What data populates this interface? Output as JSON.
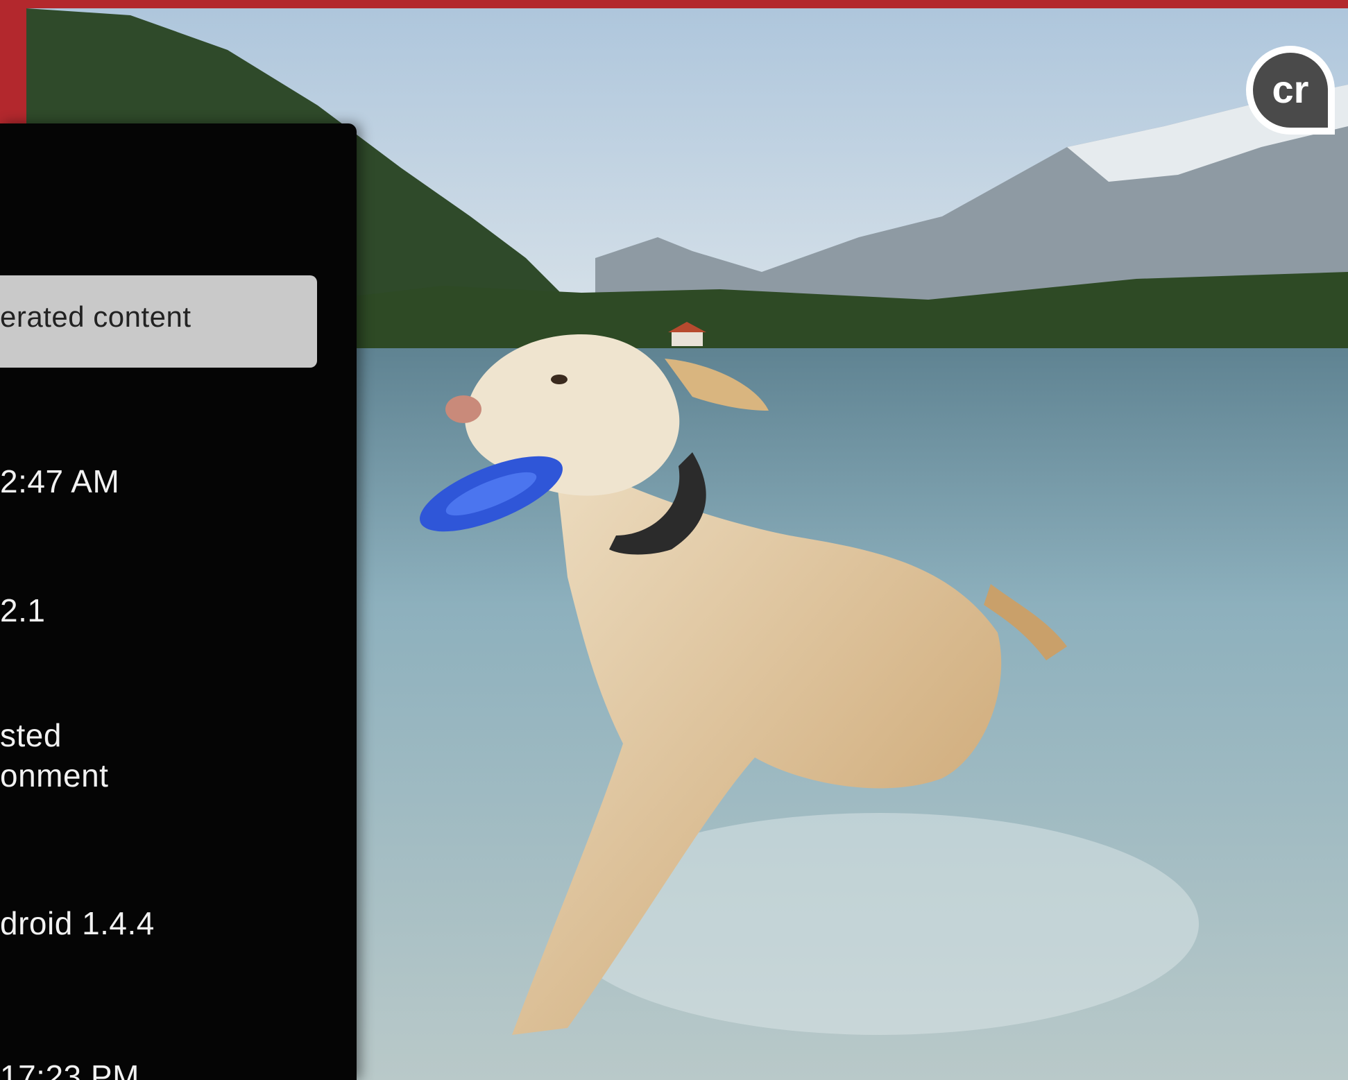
{
  "colors": {
    "accent": "#b3282d",
    "panel": "#050505",
    "selected_item": "#c9c9c9"
  },
  "panel": {
    "selected_item_label": "erated content",
    "rows": [
      {
        "value": "2:47 AM"
      },
      {
        "value": "2.1"
      },
      {
        "value": "sted\nonment"
      },
      {
        "value": "droid 1.4.4"
      },
      {
        "value": "17:23 PM"
      }
    ]
  },
  "badge": {
    "text": "cr",
    "icon": "content-credentials-icon"
  },
  "photo": {
    "icon": "photo-dog-lake"
  }
}
